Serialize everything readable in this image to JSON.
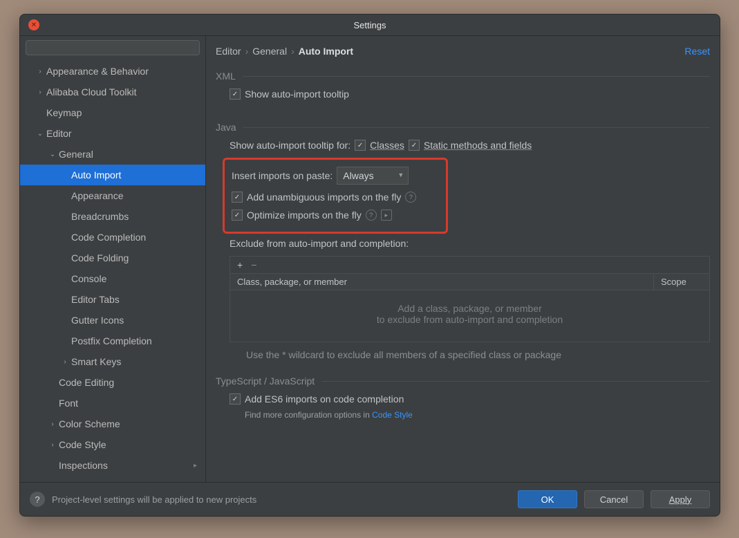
{
  "titlebar": {
    "title": "Settings"
  },
  "sidebar": {
    "search_placeholder": "",
    "items": [
      {
        "label": "Appearance & Behavior",
        "arrow": "right",
        "indent": 0
      },
      {
        "label": "Alibaba Cloud Toolkit",
        "arrow": "right",
        "indent": 0
      },
      {
        "label": "Keymap",
        "arrow": "none",
        "indent": 0
      },
      {
        "label": "Editor",
        "arrow": "down",
        "indent": 0
      },
      {
        "label": "General",
        "arrow": "down",
        "indent": 1
      },
      {
        "label": "Auto Import",
        "arrow": "none",
        "indent": 2,
        "selected": true
      },
      {
        "label": "Appearance",
        "arrow": "none",
        "indent": 2
      },
      {
        "label": "Breadcrumbs",
        "arrow": "none",
        "indent": 2
      },
      {
        "label": "Code Completion",
        "arrow": "none",
        "indent": 2
      },
      {
        "label": "Code Folding",
        "arrow": "none",
        "indent": 2
      },
      {
        "label": "Console",
        "arrow": "none",
        "indent": 2
      },
      {
        "label": "Editor Tabs",
        "arrow": "none",
        "indent": 2
      },
      {
        "label": "Gutter Icons",
        "arrow": "none",
        "indent": 2
      },
      {
        "label": "Postfix Completion",
        "arrow": "none",
        "indent": 2
      },
      {
        "label": "Smart Keys",
        "arrow": "right",
        "indent": 2
      },
      {
        "label": "Code Editing",
        "arrow": "none",
        "indent": 1
      },
      {
        "label": "Font",
        "arrow": "none",
        "indent": 1
      },
      {
        "label": "Color Scheme",
        "arrow": "right",
        "indent": 1
      },
      {
        "label": "Code Style",
        "arrow": "right",
        "indent": 1
      },
      {
        "label": "Inspections",
        "arrow": "none",
        "indent": 1,
        "badge": true
      }
    ]
  },
  "header": {
    "crumbs": [
      "Editor",
      "General",
      "Auto Import"
    ],
    "reset": "Reset"
  },
  "xml": {
    "title": "XML",
    "show_tooltip": "Show auto-import tooltip"
  },
  "java": {
    "title": "Java",
    "tooltip_for": "Show auto-import tooltip for:",
    "classes": "Classes",
    "static_methods": "Static methods and fields",
    "insert_label": "Insert imports on paste:",
    "insert_value": "Always",
    "add_unambiguous": "Add unambiguous imports on the fly",
    "optimize": "Optimize imports on the fly",
    "exclude_label": "Exclude from auto-import and completion:",
    "col_class": "Class, package, or member",
    "col_scope": "Scope",
    "placeholder_l1": "Add a class, package, or member",
    "placeholder_l2": "to exclude from auto-import and completion",
    "hint": "Use the * wildcard to exclude all members of a specified class or package"
  },
  "ts": {
    "title": "TypeScript / JavaScript",
    "add_es6": "Add ES6 imports on code completion",
    "find_more": "Find more configuration options in ",
    "code_style": "Code Style"
  },
  "footer": {
    "note": "Project-level settings will be applied to new projects",
    "ok": "OK",
    "cancel": "Cancel",
    "apply": "Apply"
  }
}
